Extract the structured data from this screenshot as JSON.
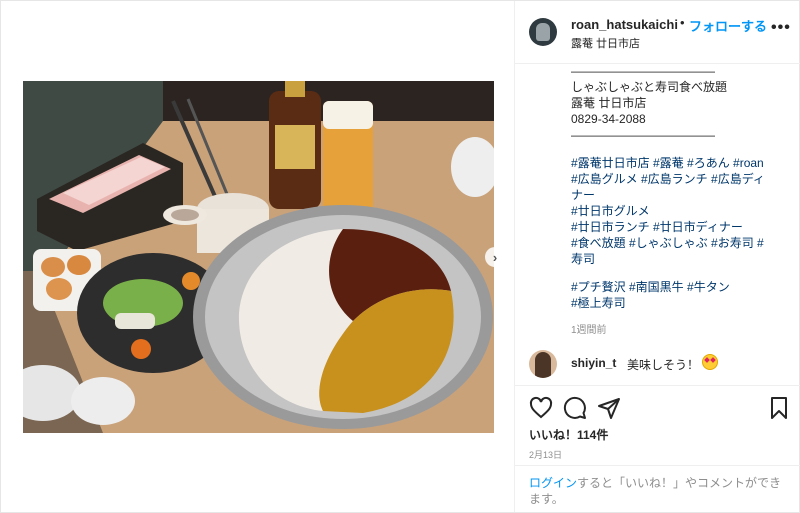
{
  "header": {
    "username": "roan_hatsukaichi",
    "separator": "•",
    "follow_label": "フォローする",
    "location": "露菴 廿日市店",
    "more_icon": "more-dots-icon"
  },
  "caption": {
    "lines": [
      "————————————",
      "しゃぶしゃぶと寿司食べ放題",
      "露菴 廿日市店",
      "0829-34-2088",
      "————————————"
    ],
    "hashtags": [
      "#露菴廿日市店 #露菴 #ろあん #roan",
      "#広島グルメ #広島ランチ #広島ディ",
      "ナー",
      "#廿日市グルメ",
      "#廿日市ランチ #廿日市ディナー",
      "#食べ放題 #しゃぶしゃぶ #お寿司 #",
      "寿司",
      "",
      "#プチ贅沢 #南国黒牛 #牛タン",
      "#極上寿司"
    ],
    "time_ago": "1週間前"
  },
  "comment": {
    "username": "shiyin_t",
    "text": "美味しそう！"
  },
  "actions": {
    "likes": "いいね！114件",
    "date": "2月13日"
  },
  "login": {
    "link": "ログイン",
    "text": "すると「いいね！」やコメントができます。"
  },
  "colors": {
    "link_blue": "#0095f6",
    "hashtag_blue": "#00376b",
    "muted": "#8e8e8e"
  }
}
